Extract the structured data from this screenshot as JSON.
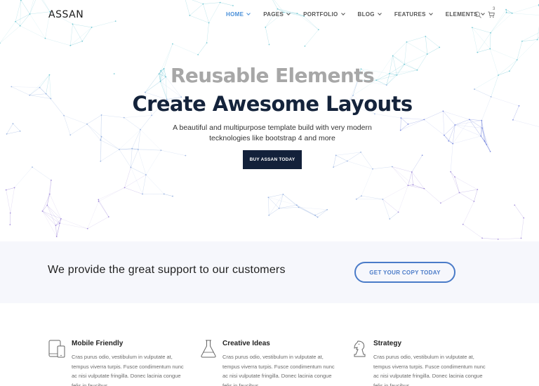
{
  "header": {
    "logo": "ASSAN",
    "menu": [
      {
        "label": "HOME",
        "active": true
      },
      {
        "label": "PAGES",
        "active": false
      },
      {
        "label": "PORTFOLIO",
        "active": false
      },
      {
        "label": "BLOG",
        "active": false
      },
      {
        "label": "FEATURES",
        "active": false
      },
      {
        "label": "ELEMENTS",
        "active": false
      }
    ],
    "cart_count": "3",
    "search_icon": "search-icon",
    "cart_icon": "cart-icon"
  },
  "hero": {
    "kicker": "Reusable Elements",
    "title": "Create Awesome Layouts",
    "subtitle": "A beautiful and multipurpose template build with very modern tecknologies like bootstrap 4 and more",
    "button_label": "BUY ASSAN TODAY"
  },
  "support": {
    "text": "We provide the great support to our customers",
    "button_label": "GET YOUR COPY TODAY"
  },
  "features": [
    {
      "icon": "devices-icon",
      "title": "Mobile Friendly",
      "text": "Cras purus odio, vestibulum in vulputate at, tempus viverra turpis. Fusce condimentum nunc ac nisi vulputate fringilla. Donec lacinia congue felis in faucibus."
    },
    {
      "icon": "flask-icon",
      "title": "Creative Ideas",
      "text": "Cras purus odio, vestibulum in vulputate at, tempus viverra turpis. Fusce condimentum nunc ac nisi vulputate fringilla. Donec lacinia congue felis in faucibus."
    },
    {
      "icon": "chess-knight-icon",
      "title": "Strategy",
      "text": "Cras purus odio, vestibulum in vulputate at, tempus viverra turpis. Fusce condimentum nunc ac nisi vulputate fringilla. Donec lacinia congue felis in faucibus."
    }
  ],
  "colors": {
    "accent": "#4a90d9",
    "dark": "#13213a",
    "band_bg": "#f6f7fc",
    "outline_button": "#4a7bc8"
  }
}
